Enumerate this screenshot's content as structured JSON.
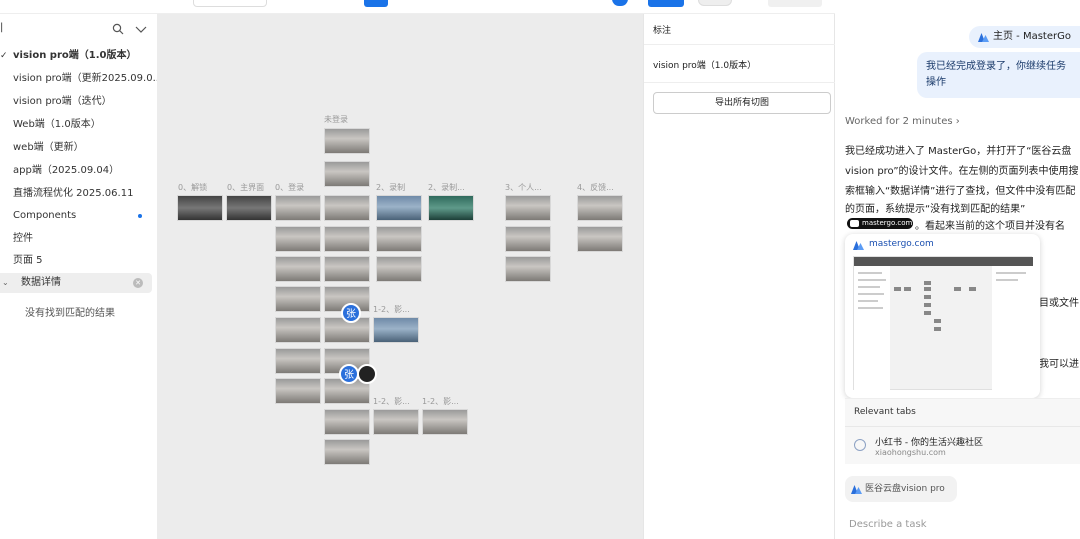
{
  "sidebar": {
    "search_icon": "search-icon",
    "collapse_icon": "chevron-down-icon",
    "items": [
      {
        "label": "vision pro端（1.0版本）",
        "selected": true
      },
      {
        "label": "vision pro端（更新2025.09.0..."
      },
      {
        "label": "vision pro端（迭代）"
      },
      {
        "label": "Web端（1.0版本）"
      },
      {
        "label": "web端（更新）"
      },
      {
        "label": "app端（2025.09.04）"
      },
      {
        "label": "直播流程优化 2025.06.11"
      },
      {
        "label": "Components"
      },
      {
        "label": "控件"
      },
      {
        "label": "页面 5"
      }
    ],
    "search_value": "数据详情",
    "empty_message": "没有找到匹配的结果",
    "accent_color": "#1a73e8"
  },
  "canvas": {
    "background": "#ececec",
    "labels": {
      "unlogged": "未登录",
      "col0": "0、解锁",
      "col1": "0、主界面",
      "col2": "0、登录",
      "col4": "2、录制",
      "col5": "2、录制...",
      "col6": "3、个人...",
      "col7": "4、反馈...",
      "mid1": "1-2、影...",
      "bot1": "1-2、影...",
      "bot2": "1-2、影..."
    },
    "avatar_letter": "张"
  },
  "props": {
    "section_title": "标注",
    "page_name": "vision pro端（1.0版本）",
    "export_button": "导出所有切图"
  },
  "chat": {
    "tab_title": "主页 - MasterGo",
    "user_message": "我已经完成登录了，你继续任务操作",
    "worked_for": "Worked for 2 minutes",
    "reply_lines": [
      "我已经成功进入了 MasterGo，并打开了“医谷云盘",
      "vision pro”的设计文件。在左侧的页面列表中使用搜",
      "索框输入“数据详情”进行了查找，但文件中没有匹配",
      "的页面，系统提示“没有找到匹配的结果”"
    ],
    "chip_label": "mastergo.com",
    "after_chip": "。看起来当前的这个项目并没有名",
    "frag_1": "目或文件",
    "frag_2": "我可以进",
    "preview_site": "mastergo.com",
    "relevant_tabs_title": "Relevant tabs",
    "relevant_tab_name": "小红书 - 你的生活兴趣社区",
    "relevant_tab_url": "xiaohongshu.com",
    "context_chip": "医谷云盘vision pro",
    "input_placeholder": "Describe a task"
  }
}
